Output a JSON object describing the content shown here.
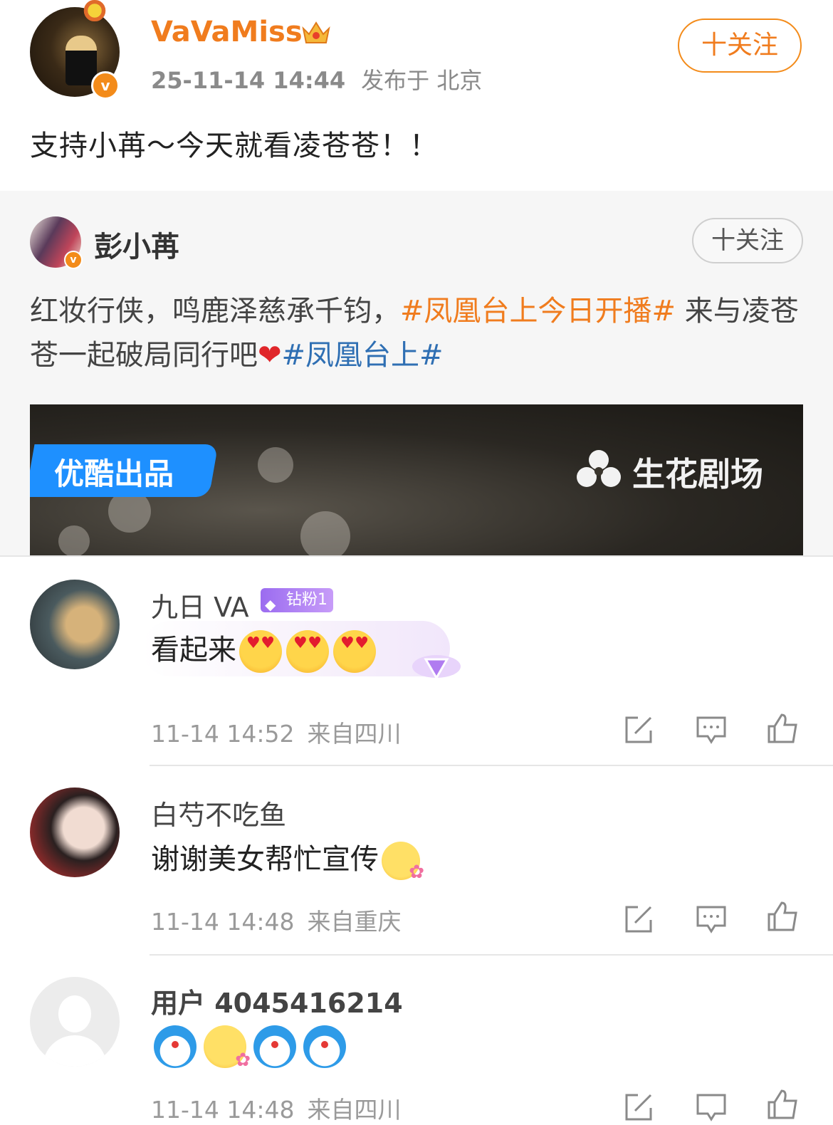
{
  "post": {
    "username": "VaVaMiss",
    "time": "25-11-14 14:44",
    "location": "发布于 北京",
    "follow_label": "十关注",
    "text": "支持小苒～今天就看凌苍苍！！",
    "avatar_icon": "user-photo-avatar",
    "verified_icon": "verified-v-badge",
    "accent_color": "#f07c1e"
  },
  "repost": {
    "username": "彭小苒",
    "follow_label": "十关注",
    "text_part1": "红妆行侠，鸣鹿泽慈承千钧，",
    "topic1": "#凤凰台上今日开播#",
    "text_part2": " 来与凌苍苍一起破局同行吧",
    "heart": "❤",
    "topic2": "#凤凰台上#",
    "banner": {
      "tag_label": "优酷出品",
      "logo_label": "生花剧场"
    }
  },
  "comments": [
    {
      "name": "九日 VA",
      "badge": "钻粉1",
      "text": "看起来",
      "time": "11-14 14:52",
      "place": "来自四川"
    },
    {
      "name": "白芍不吃鱼",
      "text": "谢谢美女帮忙宣传",
      "time": "11-14 14:48",
      "place": "来自重庆"
    },
    {
      "name": "用户 4045416214",
      "text": "",
      "time": "11-14 14:48",
      "place": "来自四川"
    }
  ]
}
